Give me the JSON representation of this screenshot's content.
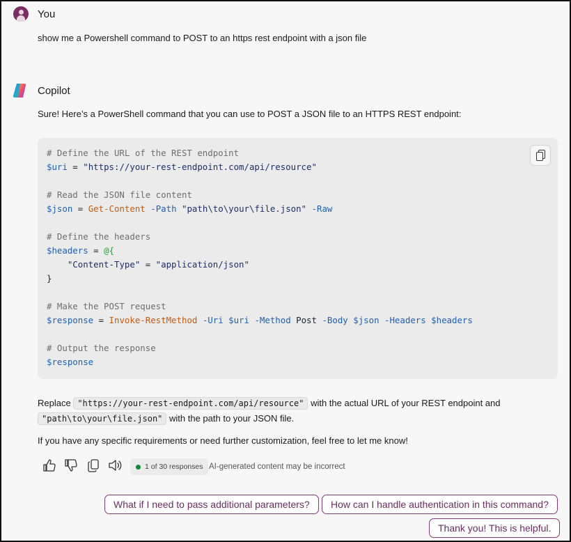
{
  "user": {
    "name": "You",
    "message": "show me a Powershell command to POST to an https rest endpoint with a json file"
  },
  "copilot": {
    "name": "Copilot",
    "intro": "Sure! Here’s a PowerShell command that you can use to POST a JSON file to an HTTPS REST endpoint:",
    "code": {
      "comment_url": "# Define the URL of the REST endpoint",
      "var_uri": "$uri",
      "op_eq": " = ",
      "uri_value": "\"https://your-rest-endpoint.com/api/resource\"",
      "comment_read": "# Read the JSON file content",
      "var_json": "$json",
      "cmd_get_content": "Get-Content",
      "param_path": "-Path",
      "path_value": "\"path\\to\\your\\file.json\"",
      "param_raw": "-Raw",
      "comment_headers": "# Define the headers",
      "var_headers": "$headers",
      "hash_open": "@{",
      "header_key": "\"Content-Type\"",
      "header_value": "\"application/json\"",
      "brace_close": "}",
      "comment_post": "# Make the POST request",
      "var_response": "$response",
      "cmd_invoke": "Invoke-RestMethod",
      "param_uri": "-Uri",
      "param_method": "-Method",
      "method_value": "Post",
      "param_body": "-Body",
      "param_headers": "-Headers",
      "comment_output": "# Output the response"
    },
    "replace_prefix": "Replace",
    "replace_code1": "\"https://your-rest-endpoint.com/api/resource\"",
    "replace_middle": "with the actual URL of your REST endpoint and",
    "replace_code2": "\"path\\to\\your\\file.json\"",
    "replace_suffix": "with the path to your JSON file.",
    "closing": "If you have any specific requirements or need further customization, feel free to let me know!",
    "response_count": "1 of 30 responses",
    "disclaimer": "AI-generated content may be incorrect"
  },
  "actions": {
    "icons": [
      "thumbs-up-icon",
      "thumbs-down-icon",
      "copy-icon",
      "read-aloud-icon"
    ]
  },
  "suggestions": [
    "What if I need to pass additional parameters?",
    "How can I handle authentication in this command?",
    "Thank you! This is helpful."
  ],
  "colors": {
    "accent_suggestion": "#8a3a7c",
    "user_avatar": "#7a2e63",
    "status_dot": "#12883a",
    "code_keyword": "#c55a11",
    "code_variable": "#1f5fb5"
  }
}
